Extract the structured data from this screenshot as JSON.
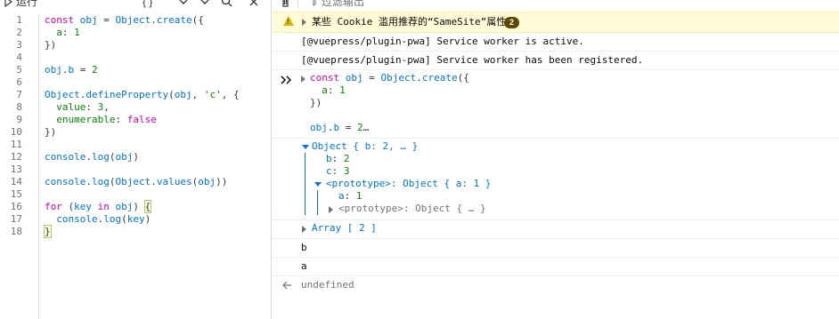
{
  "editor": {
    "toolbar": {
      "run_label": "运行",
      "pretty_print_label": "{ }"
    },
    "line_numbers": [
      "1",
      "2",
      "3",
      "4",
      "5",
      "6",
      "7",
      "8",
      "9",
      "10",
      "11",
      "12",
      "13",
      "14",
      "15",
      "16",
      "17",
      "18"
    ],
    "lines": [
      [
        {
          "t": "const ",
          "c": "kw"
        },
        {
          "t": "obj",
          "c": "id"
        },
        {
          "t": " = ",
          "c": "pl"
        },
        {
          "t": "Object",
          "c": "id"
        },
        {
          "t": ".",
          "c": "pl"
        },
        {
          "t": "create",
          "c": "id"
        },
        {
          "t": "({",
          "c": "pl"
        }
      ],
      [
        {
          "t": "  a",
          "c": "pr"
        },
        {
          "t": ": ",
          "c": "pl"
        },
        {
          "t": "1",
          "c": "nm"
        }
      ],
      [
        {
          "t": "})",
          "c": "pl"
        }
      ],
      [],
      [
        {
          "t": "obj",
          "c": "id"
        },
        {
          "t": ".",
          "c": "pl"
        },
        {
          "t": "b",
          "c": "id"
        },
        {
          "t": " = ",
          "c": "pl"
        },
        {
          "t": "2",
          "c": "nm"
        }
      ],
      [],
      [
        {
          "t": "Object",
          "c": "id"
        },
        {
          "t": ".",
          "c": "pl"
        },
        {
          "t": "defineProperty",
          "c": "id"
        },
        {
          "t": "(",
          "c": "pl"
        },
        {
          "t": "obj",
          "c": "id"
        },
        {
          "t": ", ",
          "c": "pl"
        },
        {
          "t": "'c'",
          "c": "st"
        },
        {
          "t": ", {",
          "c": "pl"
        }
      ],
      [
        {
          "t": "  value",
          "c": "pr"
        },
        {
          "t": ": ",
          "c": "pl"
        },
        {
          "t": "3",
          "c": "nm"
        },
        {
          "t": ",",
          "c": "pl"
        }
      ],
      [
        {
          "t": "  enumerable",
          "c": "pr"
        },
        {
          "t": ": ",
          "c": "pl"
        },
        {
          "t": "false",
          "c": "kw"
        }
      ],
      [
        {
          "t": "})",
          "c": "pl"
        }
      ],
      [],
      [
        {
          "t": "console",
          "c": "id"
        },
        {
          "t": ".",
          "c": "pl"
        },
        {
          "t": "log",
          "c": "id"
        },
        {
          "t": "(",
          "c": "pl"
        },
        {
          "t": "obj",
          "c": "id"
        },
        {
          "t": ")",
          "c": "pl"
        }
      ],
      [],
      [
        {
          "t": "console",
          "c": "id"
        },
        {
          "t": ".",
          "c": "pl"
        },
        {
          "t": "log",
          "c": "id"
        },
        {
          "t": "(",
          "c": "pl"
        },
        {
          "t": "Object",
          "c": "id"
        },
        {
          "t": ".",
          "c": "pl"
        },
        {
          "t": "values",
          "c": "id"
        },
        {
          "t": "(",
          "c": "pl"
        },
        {
          "t": "obj",
          "c": "id"
        },
        {
          "t": "))",
          "c": "pl"
        }
      ],
      [],
      [
        {
          "t": "for ",
          "c": "kw"
        },
        {
          "t": "(",
          "c": "pl"
        },
        {
          "t": "key ",
          "c": "id"
        },
        {
          "t": "in ",
          "c": "kw"
        },
        {
          "t": "obj",
          "c": "id"
        },
        {
          "t": ") ",
          "c": "pl"
        },
        {
          "t": "{",
          "c": "pl",
          "b": true
        }
      ],
      [
        {
          "t": "  console",
          "c": "id"
        },
        {
          "t": ".",
          "c": "pl"
        },
        {
          "t": "log",
          "c": "id"
        },
        {
          "t": "(",
          "c": "pl"
        },
        {
          "t": "key",
          "c": "id"
        },
        {
          "t": ")",
          "c": "pl"
        }
      ],
      [
        {
          "t": "}",
          "c": "pl",
          "b": true
        }
      ]
    ]
  },
  "console": {
    "toolbar": {
      "filter_placeholder": "过滤输出"
    },
    "warning": {
      "icon": "warning-icon",
      "text": "某些 Cookie 滥用推荐的“SameSite”属性",
      "count": "2",
      "color": "#fffbd6"
    },
    "logs": [
      "[@vuepress/plugin-pwa] Service worker is active.",
      "[@vuepress/plugin-pwa] Service worker has been registered."
    ],
    "input_echo": {
      "line1": "const obj = Object.create({",
      "line2": "  a: 1",
      "line3": "})",
      "line4": "obj.b = 2…"
    },
    "object_tree": {
      "header": "Object { b: 2, … }",
      "props": [
        {
          "key": "b",
          "value": "2"
        },
        {
          "key": "c",
          "value": "3"
        }
      ],
      "prototype_label": "<prototype>: Object { a: 1 }",
      "prototype_props": [
        {
          "key": "a",
          "value": "1"
        }
      ],
      "nested_prototype_label": "<prototype>: Object { … }"
    },
    "array_output": "Array [ 2 ]",
    "outputs": [
      "b",
      "a"
    ],
    "return_value": "undefined"
  }
}
